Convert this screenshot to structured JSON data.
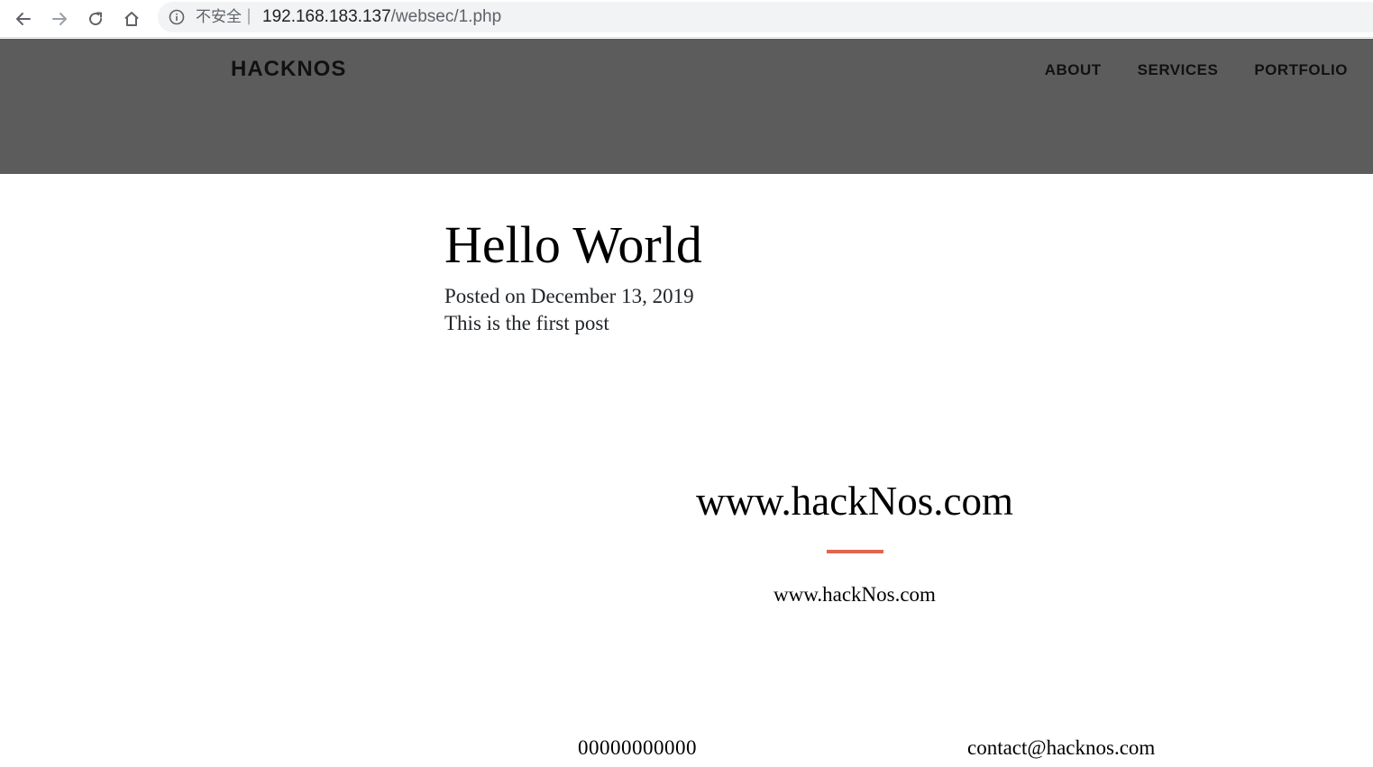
{
  "browser": {
    "security_label": "不安全",
    "separator": "|",
    "url_host": "192.168.183.137",
    "url_path": "/websec/1.php",
    "icons": [
      "back-icon",
      "forward-icon",
      "reload-icon",
      "home-icon",
      "info-icon"
    ]
  },
  "header": {
    "brand": "HACKNOS",
    "menu": [
      {
        "label": "ABOUT"
      },
      {
        "label": "SERVICES"
      },
      {
        "label": "PORTFOLIO"
      }
    ],
    "background_color": "#5c5c5c"
  },
  "post": {
    "title": "Hello World",
    "meta": "Posted on December 13, 2019",
    "body": "This is the first post"
  },
  "section": {
    "title": "www.hackNos.com",
    "subtitle": "www.hackNos.com",
    "accent_color": "#e0674e"
  },
  "contact": {
    "phone": "00000000000",
    "email": "contact@hacknos.com"
  }
}
